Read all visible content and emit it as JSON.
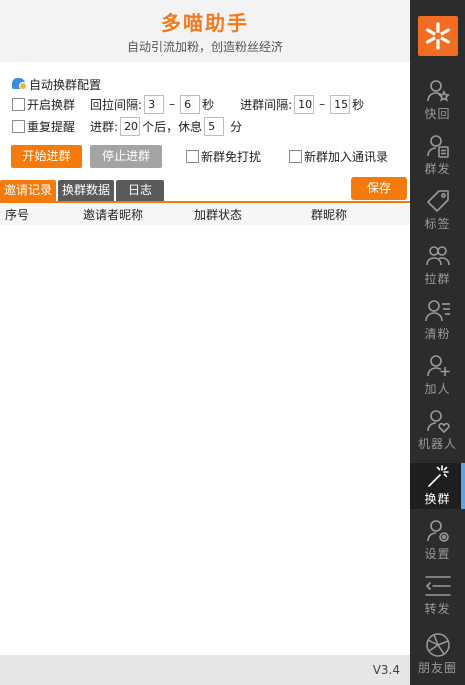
{
  "header": {
    "title": "多喵助手",
    "subtitle": "自动引流加粉，创造粉丝经济"
  },
  "config": {
    "section_title": "自动换群配置",
    "enable_switch_label": "开启换群",
    "pull_interval_label": "回拉间隔:",
    "pull_min": "3",
    "pull_max": "6",
    "sec_unit": "秒",
    "join_interval_label": "进群间隔:",
    "join_min": "10",
    "join_max": "15",
    "repeat_remind_label": "重复提醒",
    "join_count_label": "进群:",
    "join_count": "20",
    "rest_label": "个后，休息",
    "rest_minutes": "5",
    "minute_unit": "分",
    "dash": "–"
  },
  "actions": {
    "start_label": "开始进群",
    "stop_label": "停止进群",
    "no_disturb_label": "新群免打扰",
    "add_contacts_label": "新群加入通讯录"
  },
  "tabs": [
    "邀请记录",
    "换群数据",
    "日志"
  ],
  "save_label": "保存",
  "table": {
    "columns": [
      "序号",
      "邀请者昵称",
      "加群状态",
      "群昵称"
    ]
  },
  "footer": {
    "version": "V3.4"
  },
  "colors": {
    "accent": "#f47a0c",
    "sidebar_bg": "#2c2c2c",
    "active_indicator": "#5ba4e6"
  },
  "sidebar": {
    "logo_icon": "flower-logo-icon",
    "items": [
      {
        "label": "快回",
        "icon": "user-star-icon"
      },
      {
        "label": "群发",
        "icon": "user-doc-icon"
      },
      {
        "label": "标签",
        "icon": "tag-icon"
      },
      {
        "label": "拉群",
        "icon": "group-icon"
      },
      {
        "label": "清粉",
        "icon": "user-list-icon"
      },
      {
        "label": "加人",
        "icon": "user-plus-icon"
      },
      {
        "label": "机器人",
        "icon": "user-heart-icon"
      },
      {
        "label": "换群",
        "icon": "magic-wand-icon",
        "active": true
      },
      {
        "label": "设置",
        "icon": "user-gear-icon"
      },
      {
        "label": "转发",
        "icon": "forward-lines-icon"
      },
      {
        "label": "朋友圈",
        "icon": "aperture-icon"
      }
    ]
  }
}
